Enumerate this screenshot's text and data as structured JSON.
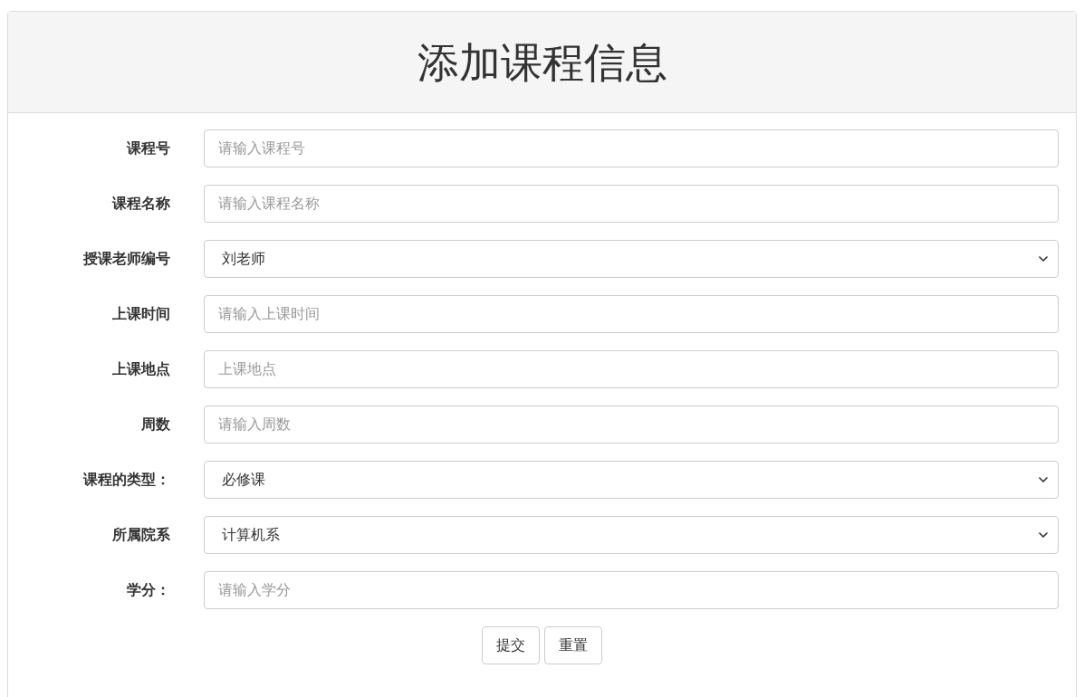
{
  "title": "添加课程信息",
  "fields": [
    {
      "label": "课程号",
      "kind": "input",
      "placeholder": "请输入课程号"
    },
    {
      "label": "课程名称",
      "kind": "input",
      "placeholder": "请输入课程名称"
    },
    {
      "label": "授课老师编号",
      "kind": "select",
      "value": "刘老师"
    },
    {
      "label": "上课时间",
      "kind": "input",
      "placeholder": "请输入上课时间"
    },
    {
      "label": "上课地点",
      "kind": "input",
      "placeholder": "上课地点"
    },
    {
      "label": "周数",
      "kind": "input",
      "placeholder": "请输入周数"
    },
    {
      "label": "课程的类型：",
      "kind": "select",
      "value": "必修课"
    },
    {
      "label": "所属院系",
      "kind": "select",
      "value": "计算机系"
    },
    {
      "label": "学分：",
      "kind": "input",
      "placeholder": "请输入学分"
    }
  ],
  "buttons": [
    "提交",
    "重置"
  ]
}
